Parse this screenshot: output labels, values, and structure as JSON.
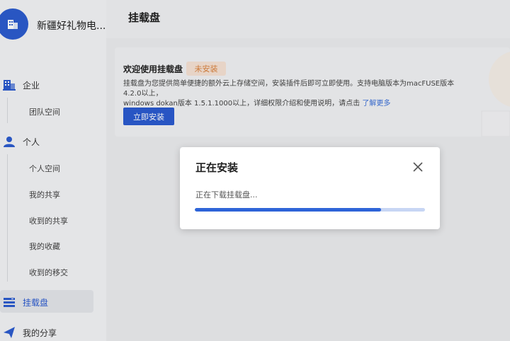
{
  "org": {
    "name": "新疆好礼物电..."
  },
  "sidebar": {
    "groups": [
      {
        "label": "企业",
        "icon": "building-icon",
        "items": [
          "团队空间"
        ]
      },
      {
        "label": "个人",
        "icon": "person-icon",
        "items": [
          "个人空间",
          "我的共享",
          "收到的共享",
          "我的收藏",
          "收到的移交"
        ]
      }
    ],
    "mount": {
      "label": "挂载盘",
      "icon": "mount-disk-icon"
    },
    "share": {
      "label": "我的分享",
      "icon": "send-icon"
    }
  },
  "page": {
    "title": "挂载盘"
  },
  "card": {
    "welcome": "欢迎使用挂载盘",
    "badge": "未安装",
    "desc_line1": "挂载盘为您提供简单便捷的额外云上存储空间，安装插件后即可立即使用。支持电脑版本为macFUSE版本4.2.0以上，",
    "desc_line2": "windows dokan版本 1.5.1.1000以上，详细权限介绍和使用说明，请点击",
    "learn_more": "了解更多",
    "install_label": "立即安装"
  },
  "dialog": {
    "title": "正在安装",
    "status": "正在下载挂载盘...",
    "progress": 0.81,
    "close_icon": "close-icon"
  },
  "colors": {
    "accent": "#2b5bd0",
    "badge_text": "#d9823e",
    "badge_bg": "#f6e2d4"
  }
}
